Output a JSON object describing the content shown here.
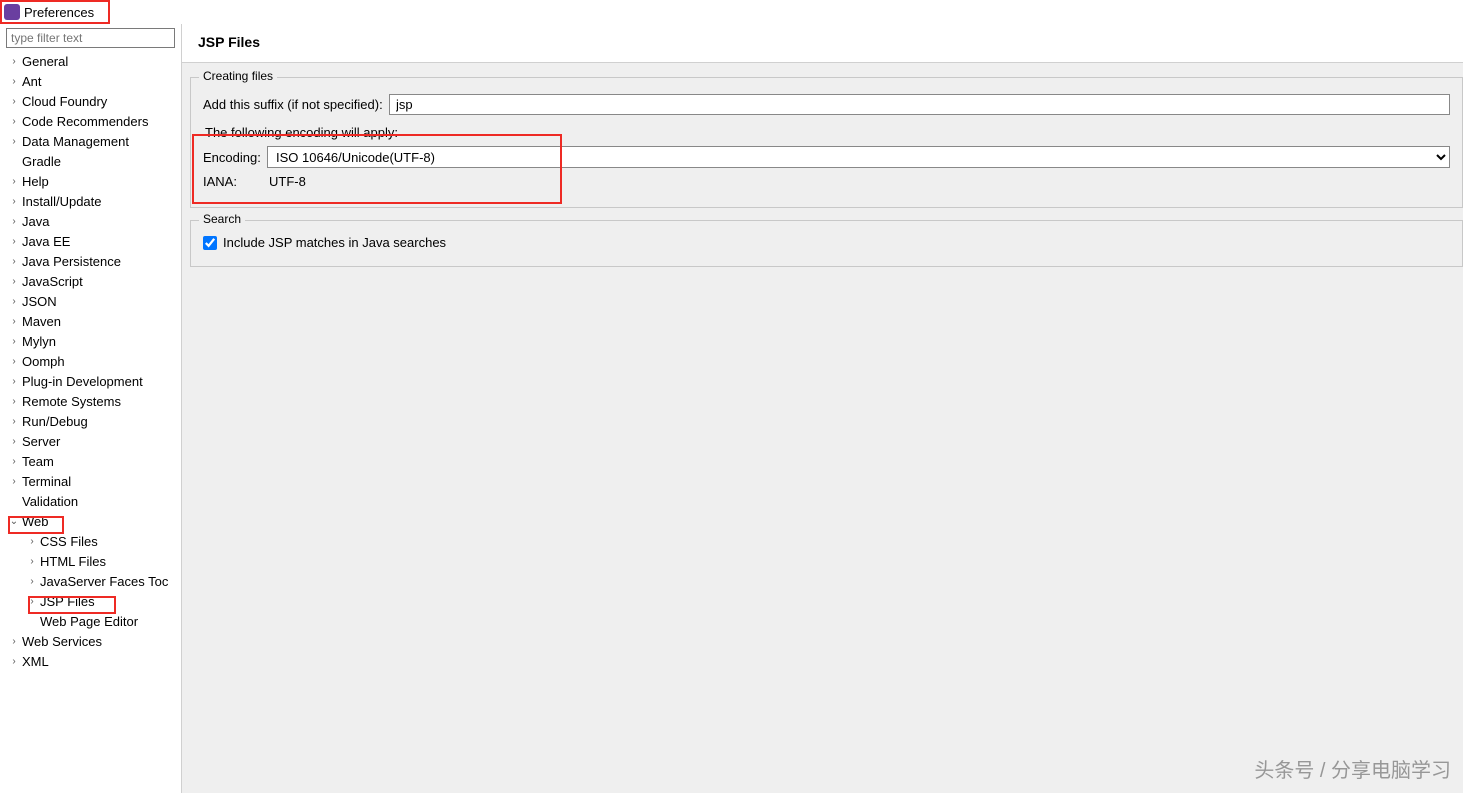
{
  "window": {
    "title": "Preferences"
  },
  "filter": {
    "placeholder": "type filter text"
  },
  "tree": {
    "items": [
      {
        "label": "General",
        "caret": ">",
        "indent": false
      },
      {
        "label": "Ant",
        "caret": ">",
        "indent": false
      },
      {
        "label": "Cloud Foundry",
        "caret": ">",
        "indent": false
      },
      {
        "label": "Code Recommenders",
        "caret": ">",
        "indent": false
      },
      {
        "label": "Data Management",
        "caret": ">",
        "indent": false
      },
      {
        "label": "Gradle",
        "caret": "",
        "indent": false
      },
      {
        "label": "Help",
        "caret": ">",
        "indent": false
      },
      {
        "label": "Install/Update",
        "caret": ">",
        "indent": false
      },
      {
        "label": "Java",
        "caret": ">",
        "indent": false
      },
      {
        "label": "Java EE",
        "caret": ">",
        "indent": false
      },
      {
        "label": "Java Persistence",
        "caret": ">",
        "indent": false
      },
      {
        "label": "JavaScript",
        "caret": ">",
        "indent": false
      },
      {
        "label": "JSON",
        "caret": ">",
        "indent": false
      },
      {
        "label": "Maven",
        "caret": ">",
        "indent": false
      },
      {
        "label": "Mylyn",
        "caret": ">",
        "indent": false
      },
      {
        "label": "Oomph",
        "caret": ">",
        "indent": false
      },
      {
        "label": "Plug-in Development",
        "caret": ">",
        "indent": false
      },
      {
        "label": "Remote Systems",
        "caret": ">",
        "indent": false
      },
      {
        "label": "Run/Debug",
        "caret": ">",
        "indent": false
      },
      {
        "label": "Server",
        "caret": ">",
        "indent": false
      },
      {
        "label": "Team",
        "caret": ">",
        "indent": false
      },
      {
        "label": "Terminal",
        "caret": ">",
        "indent": false
      },
      {
        "label": "Validation",
        "caret": "",
        "indent": false
      },
      {
        "label": "Web",
        "caret": "v",
        "indent": false
      },
      {
        "label": "CSS Files",
        "caret": ">",
        "indent": true
      },
      {
        "label": "HTML Files",
        "caret": ">",
        "indent": true
      },
      {
        "label": "JavaServer Faces Toc",
        "caret": ">",
        "indent": true
      },
      {
        "label": "JSP Files",
        "caret": ">",
        "indent": true
      },
      {
        "label": "Web Page Editor",
        "caret": "",
        "indent": true
      },
      {
        "label": "Web Services",
        "caret": ">",
        "indent": false
      },
      {
        "label": "XML",
        "caret": ">",
        "indent": false
      }
    ]
  },
  "page": {
    "title": "JSP Files",
    "creating": {
      "legend": "Creating files",
      "suffix_label": "Add this suffix (if not specified):",
      "suffix_value": "jsp",
      "note": "The following encoding will apply:",
      "encoding_label": "Encoding:",
      "encoding_value": "ISO 10646/Unicode(UTF-8)",
      "iana_label": "IANA:",
      "iana_value": "UTF-8"
    },
    "search": {
      "legend": "Search",
      "include_label": "Include JSP matches in Java searches",
      "include_checked": true
    }
  },
  "watermark": "头条号 / 分享电脑学习"
}
